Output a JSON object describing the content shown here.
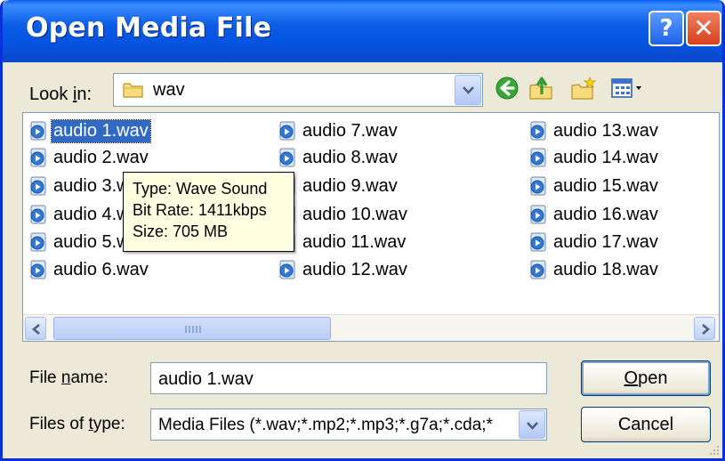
{
  "window": {
    "title": "Open Media File"
  },
  "titlebar": {
    "help_label": "?",
    "close_label": "✕"
  },
  "lookin": {
    "label_pre": "Look ",
    "label_accel": "i",
    "label_post": "n:",
    "value": "wav"
  },
  "toolbar": {
    "icons": [
      "back-icon",
      "up-folder-icon",
      "new-folder-icon",
      "view-menu-icon"
    ]
  },
  "files": [
    "audio 1.wav",
    "audio 2.wav",
    "audio 3.wav",
    "audio 4.wav",
    "audio 5.wav",
    "audio 6.wav",
    "audio 7.wav",
    "audio 8.wav",
    "audio 9.wav",
    "audio 10.wav",
    "audio 11.wav",
    "audio 12.wav",
    "audio 13.wav",
    "audio 14.wav",
    "audio 15.wav",
    "audio 16.wav",
    "audio 17.wav",
    "audio 18.wav"
  ],
  "tooltip": {
    "type": "Type: Wave Sound",
    "bitrate": "Bit Rate: 1411kbps",
    "size": "Size: 705 MB"
  },
  "form": {
    "filename_label_pre": "File ",
    "filename_label_accel": "n",
    "filename_label_post": "ame:",
    "filename_value": "audio 1.wav",
    "filetype_label_pre": "Files of ",
    "filetype_label_accel": "t",
    "filetype_label_post": "ype:",
    "filetype_value": "Media Files (*.wav;*.mp2;*.mp3;*.g7a;*.cda;*"
  },
  "buttons": {
    "open_accel": "O",
    "open_rest": "pen",
    "cancel": "Cancel"
  },
  "colors": {
    "titlebar": "#0553e1",
    "selection": "#316ac5",
    "tooltip_bg": "#ffffe1",
    "dialog_bg": "#ece9d8"
  }
}
